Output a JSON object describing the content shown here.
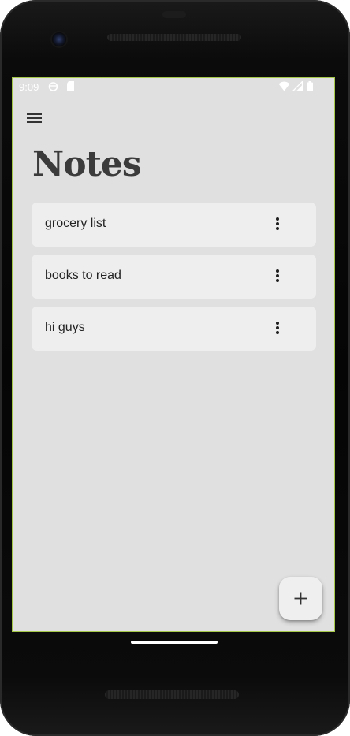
{
  "status_bar": {
    "time": "9:09",
    "icons": [
      "alarm-icon",
      "sd-card-icon",
      "wifi-icon",
      "signal-icon",
      "battery-icon"
    ]
  },
  "toolbar": {
    "menu_icon": "hamburger-menu-icon"
  },
  "page": {
    "title": "Notes"
  },
  "notes": [
    {
      "title": "grocery list",
      "menu_icon": "more-vert-icon"
    },
    {
      "title": "books to read",
      "menu_icon": "more-vert-icon"
    },
    {
      "title": "hi guys",
      "menu_icon": "more-vert-icon"
    }
  ],
  "fab": {
    "icon": "plus-icon"
  },
  "colors": {
    "screen_background": "#e0e0e0",
    "card_background": "#eeeeee",
    "title_text": "#3b3b3b",
    "screen_border": "#a6c84a"
  }
}
